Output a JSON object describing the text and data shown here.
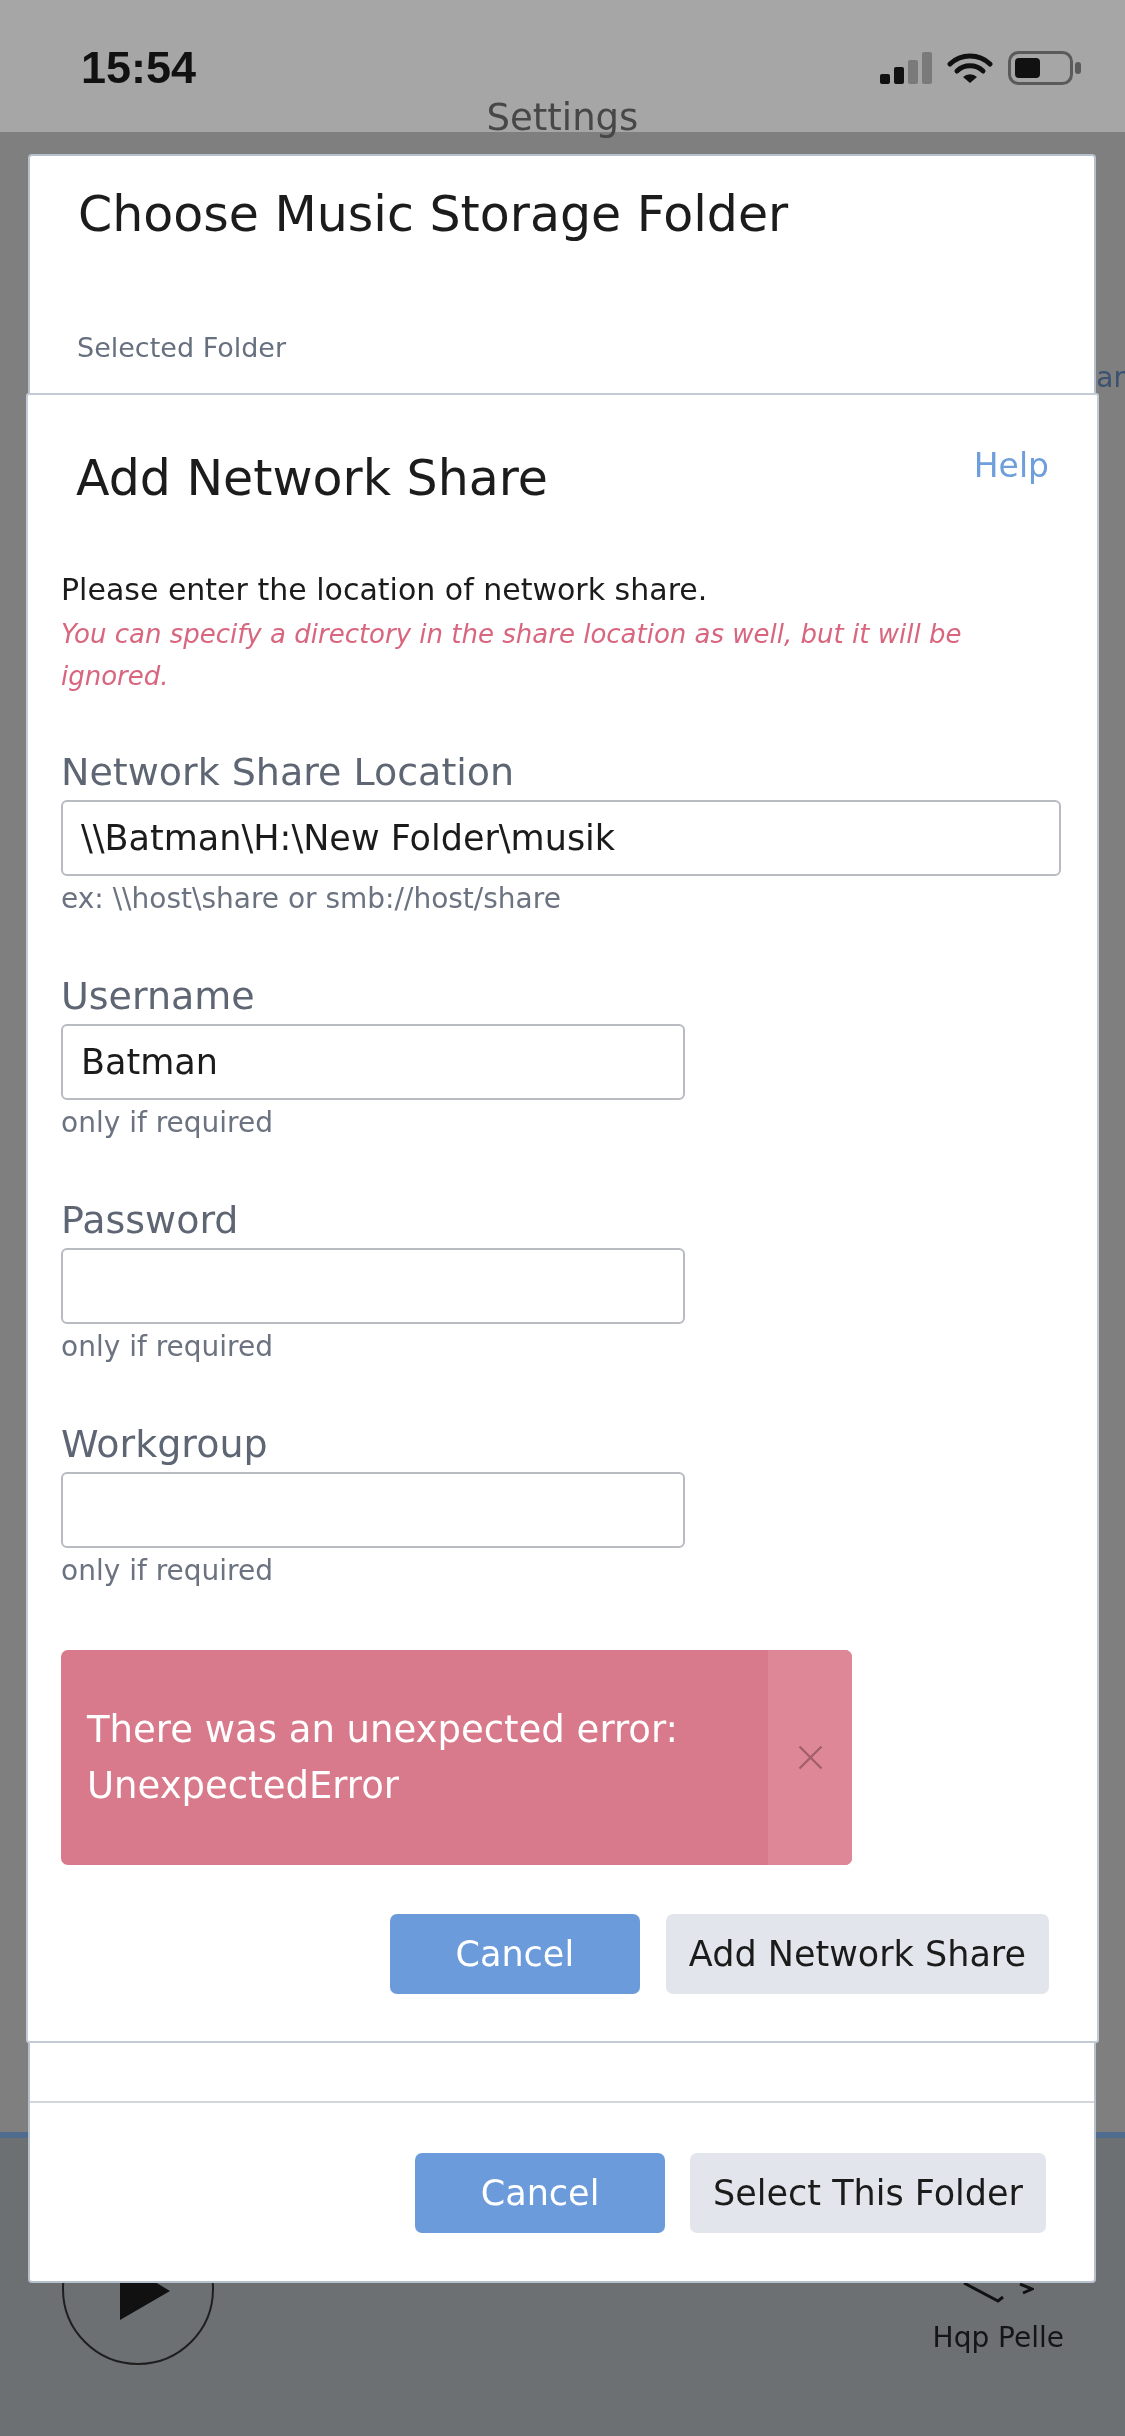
{
  "status_bar": {
    "time": "15:54"
  },
  "header": {
    "title": "Settings"
  },
  "background": {
    "cut_text": "ar"
  },
  "player": {
    "device_name": "Hqp Pelle"
  },
  "folder_dialog": {
    "title": "Choose Music Storage Folder",
    "section_label": "Selected Folder",
    "buttons": [
      {
        "label": "Cancel",
        "kind": "primary"
      },
      {
        "label": "Select This Folder",
        "kind": "secondary"
      }
    ]
  },
  "network_share_dialog": {
    "title": "Add Network Share",
    "help_link": "Help",
    "instruction": "Please enter the location of network share.",
    "note": "You can specify a directory in the share location as well, but it will be ignored.",
    "fields": [
      {
        "label": "Network Share Location",
        "kind": "location",
        "value": "\\\\Batman\\H:\\New Folder\\musik",
        "hint": "ex: \\\\host\\share or smb://host/share"
      },
      {
        "label": "Username",
        "kind": "text",
        "value": "Batman",
        "hint": "only if required"
      },
      {
        "label": "Password",
        "kind": "password",
        "hint": "only if required"
      },
      {
        "label": "Workgroup",
        "kind": "text",
        "hint": "only if required"
      }
    ],
    "error": {
      "message": "There was an unexpected error: UnexpectedError",
      "dismissible": true
    },
    "buttons": [
      {
        "label": "Cancel",
        "kind": "primary"
      },
      {
        "label": "Add Network Share",
        "kind": "secondary"
      }
    ]
  }
}
